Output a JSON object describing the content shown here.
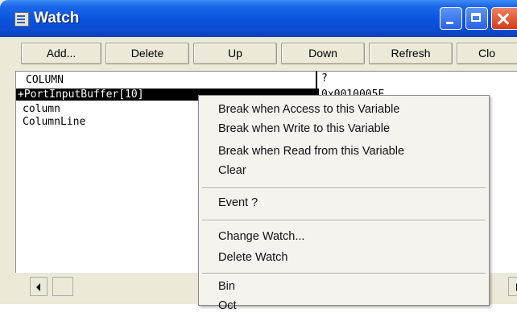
{
  "window": {
    "title": "Watch"
  },
  "toolbar": {
    "add": "Add...",
    "delete": "Delete",
    "up": "Up",
    "down": "Down",
    "refresh": "Refresh",
    "close": "Clo"
  },
  "watch_list": {
    "rows": [
      {
        "name": "COLUMN",
        "value": "?"
      },
      {
        "name": "+PortInputBuffer[10]",
        "value": "0x0010005E"
      },
      {
        "name": "column",
        "value": ""
      },
      {
        "name": "ColumnLine",
        "value": ""
      }
    ]
  },
  "context_menu": {
    "items": [
      "Break when Access to this Variable",
      "Break when Write to this Variable",
      "Break when Read from this Variable",
      "Clear",
      "Event ?",
      "Change Watch...",
      "Delete Watch",
      "Bin",
      "Oct"
    ]
  },
  "colors": {
    "title_bar": "#0a52dc",
    "selection": "#000000"
  }
}
